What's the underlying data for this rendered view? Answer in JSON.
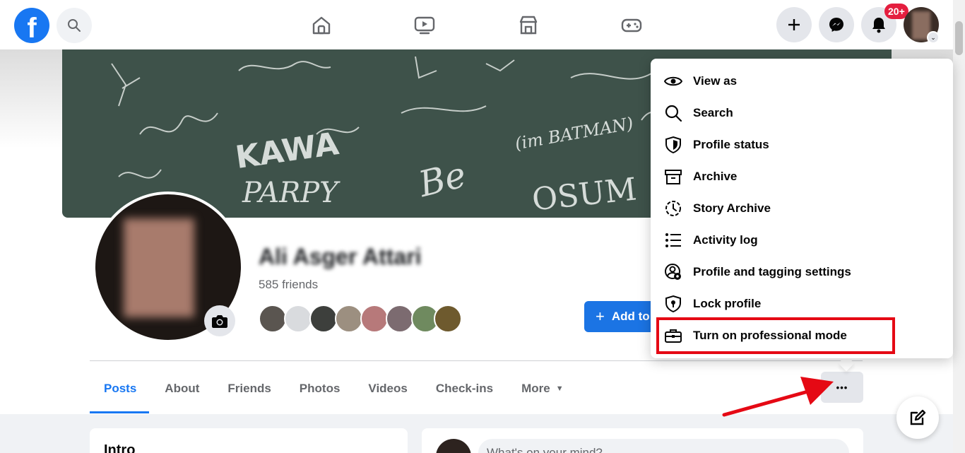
{
  "nav": {
    "logo_letter": "f",
    "notifications_badge": "20+"
  },
  "profile": {
    "name": "Ali Asger Attari",
    "friends": "585 friends",
    "add_button": "Add to story",
    "add_plus": "+",
    "cover_scribbles": [
      "KAWA",
      "PARPY",
      "(im BATMAN)",
      "Be",
      "OSUM"
    ]
  },
  "tabs": {
    "posts": "Posts",
    "about": "About",
    "friends": "Friends",
    "photos": "Photos",
    "videos": "Videos",
    "checkins": "Check-ins",
    "more": "More",
    "more_caret": "▼",
    "dots": "•••"
  },
  "menu": {
    "items": [
      {
        "label": "View as",
        "icon": "eye-icon"
      },
      {
        "label": "Search",
        "icon": "search-icon"
      },
      {
        "label": "Profile status",
        "icon": "shield-icon"
      },
      {
        "label": "Archive",
        "icon": "archive-icon"
      },
      {
        "label": "Story Archive",
        "icon": "story-archive-icon"
      },
      {
        "label": "Activity log",
        "icon": "list-icon"
      },
      {
        "label": "Profile and tagging settings",
        "icon": "profile-settings-icon"
      },
      {
        "label": "Lock profile",
        "icon": "lock-shield-icon"
      },
      {
        "label": "Turn on professional mode",
        "icon": "briefcase-icon"
      }
    ]
  },
  "bottom": {
    "intro_title": "Intro",
    "post_placeholder": "What's on your mind?"
  },
  "colors": {
    "brand": "#1877f2",
    "badge": "#e41e3f",
    "annotation": "#e50914"
  }
}
